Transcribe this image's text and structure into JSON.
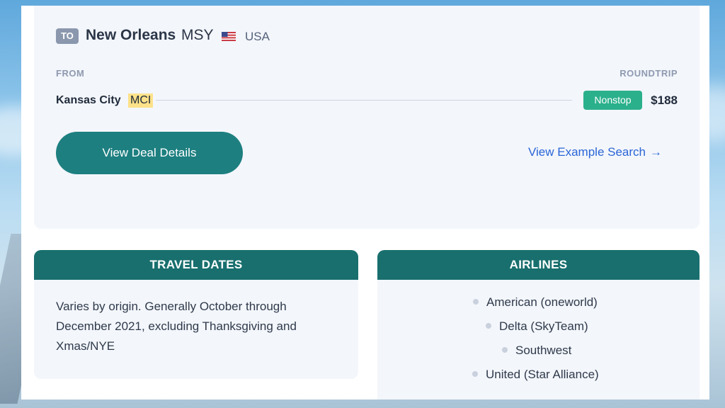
{
  "destination": {
    "badge": "TO",
    "city": "New Orleans",
    "code": "MSY",
    "country": "USA",
    "flag_icon": "us-flag-icon"
  },
  "route": {
    "from_label": "FROM",
    "trip_label": "ROUNDTRIP",
    "origin_city": "Kansas City",
    "origin_code": "MCI",
    "stops": "Nonstop",
    "price": "$188"
  },
  "actions": {
    "details_button": "View Deal Details",
    "example_link": "View Example Search",
    "example_arrow": "→"
  },
  "travel_dates": {
    "header": "TRAVEL DATES",
    "text": "Varies by origin. Generally October through December 2021, excluding Thanksgiving and Xmas/NYE"
  },
  "airlines": {
    "header": "AIRLINES",
    "items": [
      "American (oneworld)",
      "Delta (SkyTeam)",
      "Southwest",
      "United (Star Alliance)"
    ]
  },
  "colors": {
    "accent": "#1d7f80",
    "panel_header": "#186f6e",
    "nonstop_badge": "#2bb08c",
    "link": "#2a66d6",
    "highlight": "#fde28a"
  }
}
